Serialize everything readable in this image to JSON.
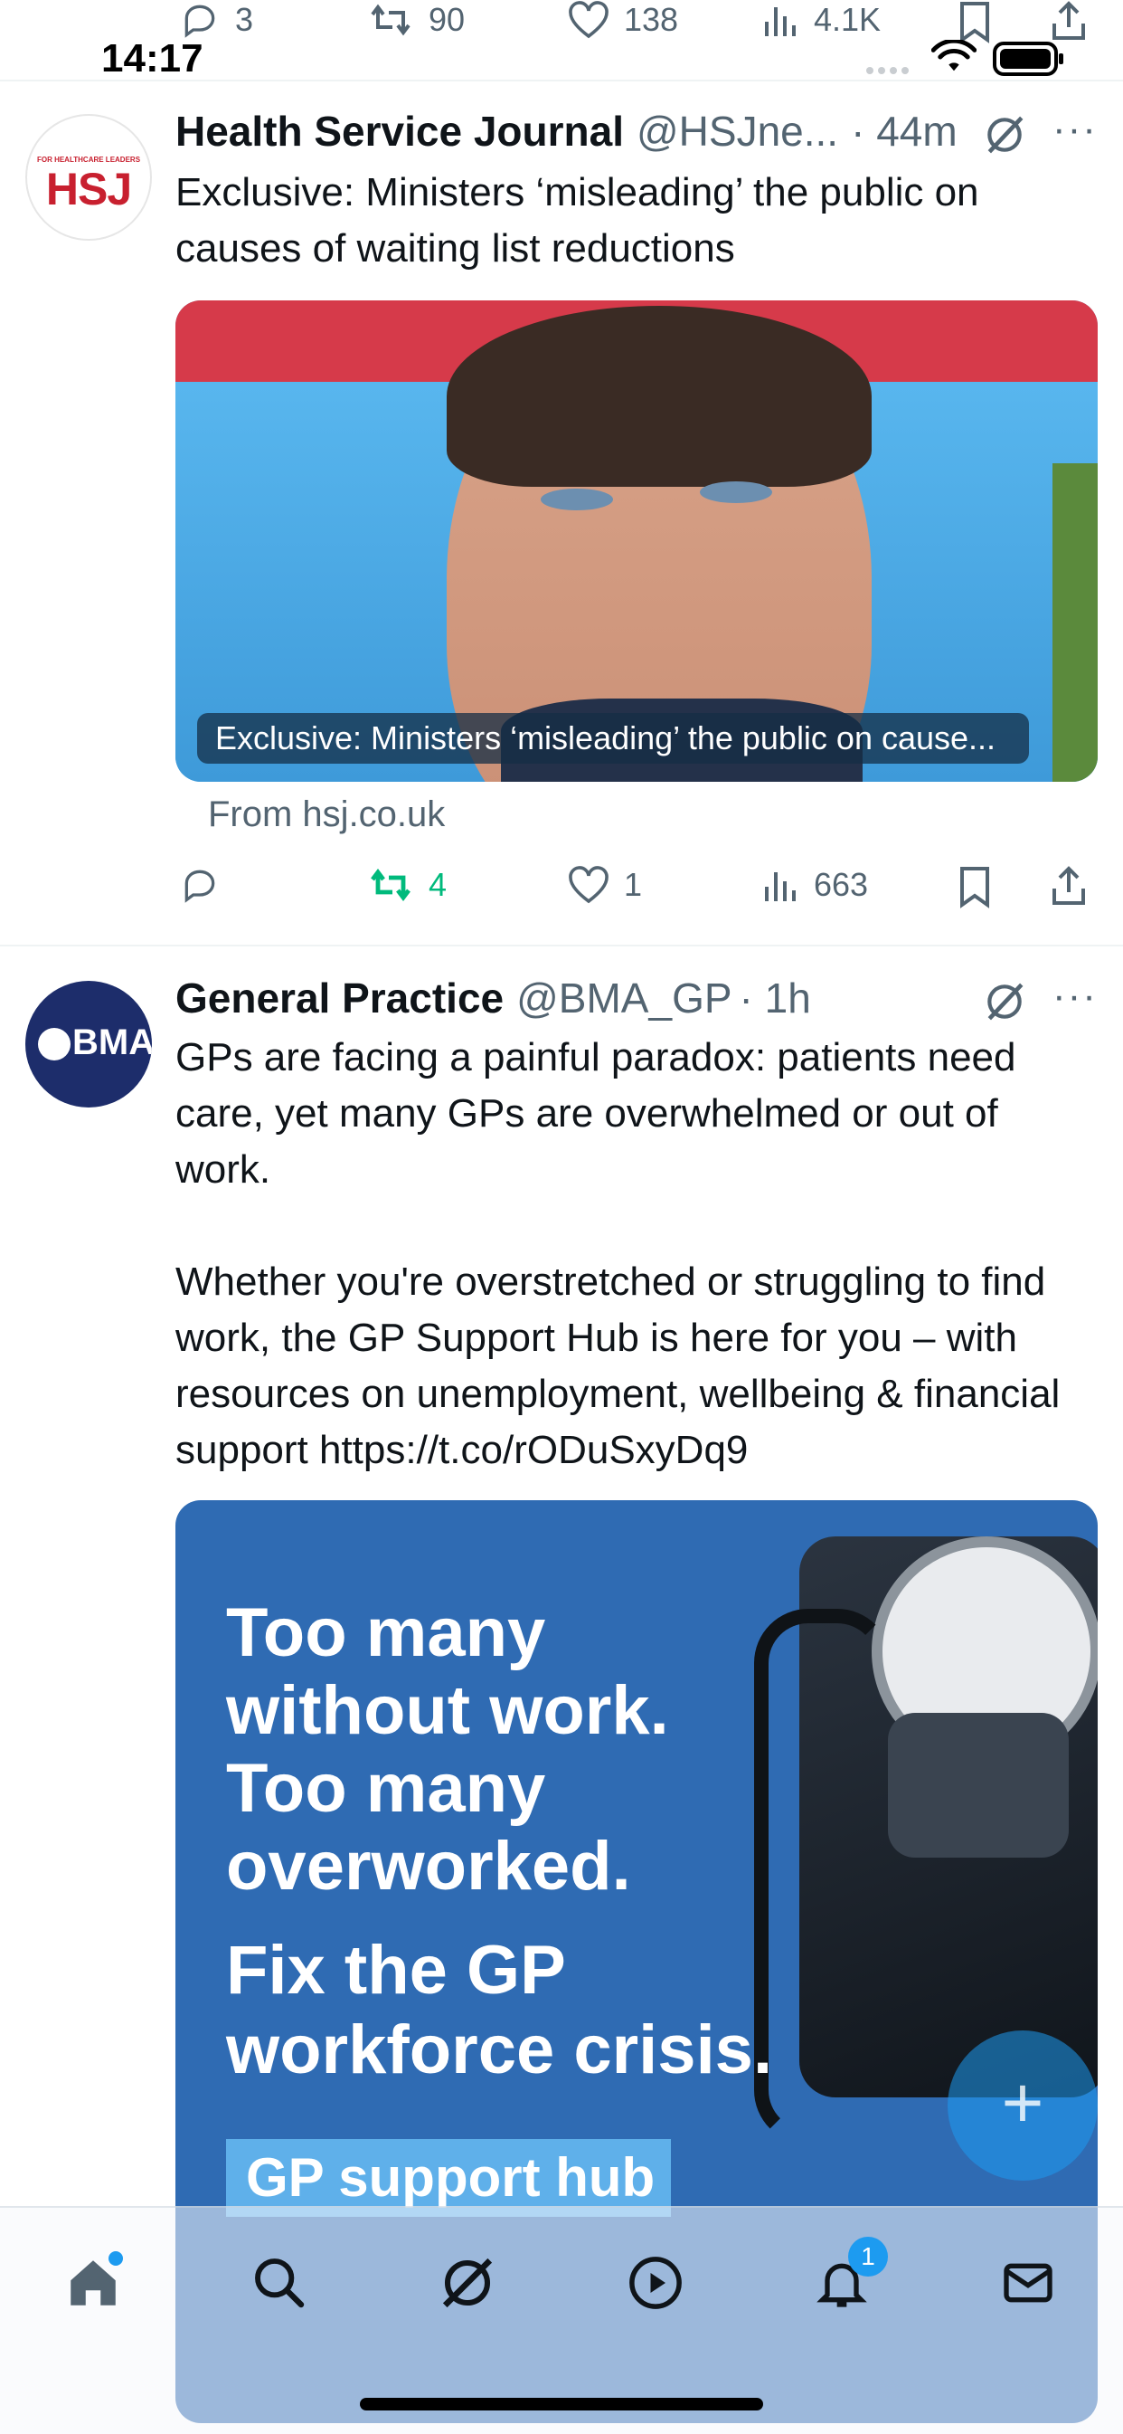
{
  "status_bar": {
    "time": "14:17"
  },
  "prev_tweet_actions": {
    "replies": "3",
    "reposts": "90",
    "likes": "138",
    "views": "4.1K"
  },
  "tweets": [
    {
      "author_name": "Health Service Journal",
      "handle": "@HSJne...",
      "time": "· 44m",
      "avatar_text": "HSJ",
      "avatar_subtext": "FOR HEALTHCARE LEADERS",
      "text": "Exclusive: Ministers ‘misleading’ the public on causes of waiting list reductions",
      "card_caption": "Exclusive: Ministers ‘misleading’ the public on cause...",
      "card_source": "From hsj.co.uk",
      "actions": {
        "replies": "",
        "reposts": "4",
        "likes": "1",
        "views": "663"
      }
    },
    {
      "author_name": "General Practice",
      "handle": "@BMA_GP",
      "time": "· 1h",
      "avatar_text": "BMA",
      "text": "GPs are facing a painful paradox: patients need care, yet many GPs are overwhelmed or out of work.\n\nWhether you're overstretched or struggling to find work, the GP Support Hub is here for you – with resources on unemployment, wellbeing & financial support https://t.co/rODuSxyDq9",
      "image_lines": [
        "Too many",
        "without work.",
        "Too many",
        "overworked.",
        "Fix the GP",
        "workforce crisis."
      ],
      "image_button": "GP support hub"
    }
  ],
  "fab": {
    "label": "+"
  },
  "nav": {
    "items": [
      "home-icon",
      "search-icon",
      "grok-icon",
      "video-icon",
      "notifications-icon",
      "messages-icon"
    ],
    "notification_badge": "1"
  },
  "colors": {
    "accent": "#1d9bf0",
    "repost_green": "#00ba7c",
    "muted": "#536471",
    "bma_navy": "#1d2d6b",
    "bma_blue": "#2f6bb3"
  }
}
